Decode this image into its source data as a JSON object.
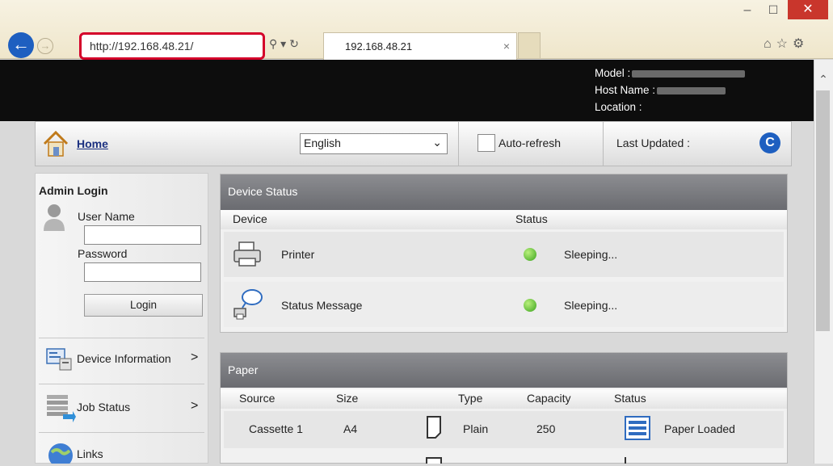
{
  "browser": {
    "url": "http://192.168.48.21/",
    "tab_title": "192.168.48.21",
    "tab_close": "×"
  },
  "header": {
    "model_label": "Model :",
    "host_label": "Host Name :",
    "location_label": "Location :"
  },
  "nav": {
    "home": "Home",
    "language": "English",
    "auto_refresh": "Auto-refresh",
    "last_updated": "Last Updated :"
  },
  "admin": {
    "title": "Admin Login",
    "user_label": "User Name",
    "password_label": "Password",
    "login_button": "Login"
  },
  "menu": [
    {
      "label": "Device Information",
      "chevron": ">"
    },
    {
      "label": "Job Status",
      "chevron": ">"
    },
    {
      "label": "Links",
      "chevron": ""
    }
  ],
  "device_status": {
    "title": "Device Status",
    "col_device": "Device",
    "col_status": "Status",
    "rows": [
      {
        "name": "Printer",
        "status": "Sleeping..."
      },
      {
        "name": "Status Message",
        "status": "Sleeping..."
      }
    ]
  },
  "paper": {
    "title": "Paper",
    "cols": [
      "Source",
      "Size",
      "Type",
      "Capacity",
      "Status"
    ],
    "rows": [
      {
        "source": "Cassette 1",
        "size": "A4",
        "type": "Plain",
        "capacity": "250",
        "status": "Paper Loaded"
      }
    ]
  },
  "colors": {
    "accent_red": "#d4002a",
    "link_blue": "#1b3080",
    "status_green": "#3aa31e"
  }
}
